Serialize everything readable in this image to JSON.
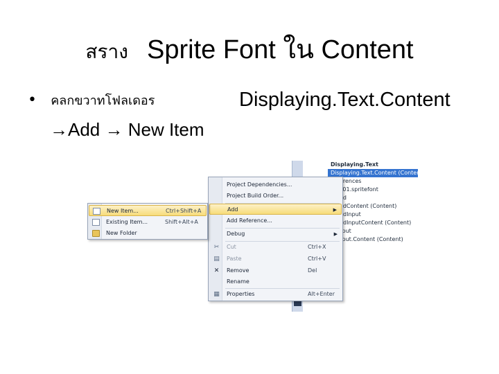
{
  "slide": {
    "title_thai": "สราง",
    "title_main": "Sprite Font ใน Content",
    "bullet_thai": "คลกขวาทโฟลเดอร",
    "bullet_project": "Displaying.Text.Content",
    "sub_line": "Add  New Item"
  },
  "explorer": {
    "items": [
      "Displaying.Text",
      "Displaying.Text.Content (Content)",
      "References",
      "Font01.spritefont",
      "World",
      "WorldContent (Content)",
      "boardInput",
      "boardInputContent (Content)",
      "seInput",
      "seInput.Content (Content)"
    ]
  },
  "context_menu": {
    "project_dependencies": "Project Dependencies...",
    "project_build_order": "Project Build Order...",
    "add": "Add",
    "add_reference": "Add Reference...",
    "debug": "Debug",
    "cut": "Cut",
    "cut_shortcut": "Ctrl+X",
    "paste": "Paste",
    "paste_shortcut": "Ctrl+V",
    "remove": "Remove",
    "remove_shortcut": "Del",
    "rename": "Rename",
    "properties": "Properties",
    "properties_shortcut": "Alt+Enter"
  },
  "submenu": {
    "new_item": "New Item...",
    "new_item_shortcut": "Ctrl+Shift+A",
    "existing_item": "Existing Item...",
    "existing_item_shortcut": "Shift+Alt+A",
    "new_folder": "New Folder"
  },
  "colors": {
    "highlight": "#f7dc7a",
    "selection": "#3574d0",
    "menu_bg": "#f2f4f8"
  }
}
